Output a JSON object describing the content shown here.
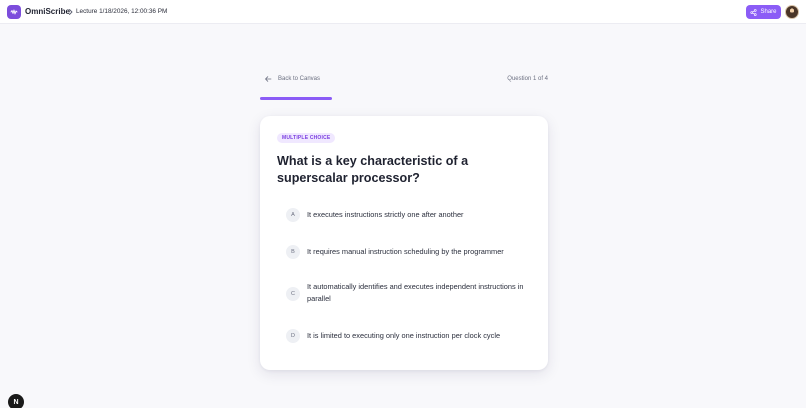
{
  "app": {
    "brand": "OmniScribe",
    "breadcrumb": "Lecture 1/18/2026, 12:00:36 PM",
    "share_label": "Share",
    "accent_color": "#8b5cf6"
  },
  "quiz": {
    "back_label": "Back to Canvas",
    "progress_label": "Question 1 of 4",
    "progress_fraction": 0.25,
    "question_type": "MULTIPLE CHOICE",
    "question": "What is a key characteristic of a superscalar processor?",
    "options": [
      {
        "letter": "A",
        "text": "It executes instructions strictly one after another"
      },
      {
        "letter": "B",
        "text": "It requires manual instruction scheduling by the programmer"
      },
      {
        "letter": "C",
        "text": "It automatically identifies and executes independent instructions in parallel"
      },
      {
        "letter": "D",
        "text": "It is limited to executing only one instruction per clock cycle"
      }
    ]
  },
  "footer": {
    "dev_badge": "N"
  }
}
